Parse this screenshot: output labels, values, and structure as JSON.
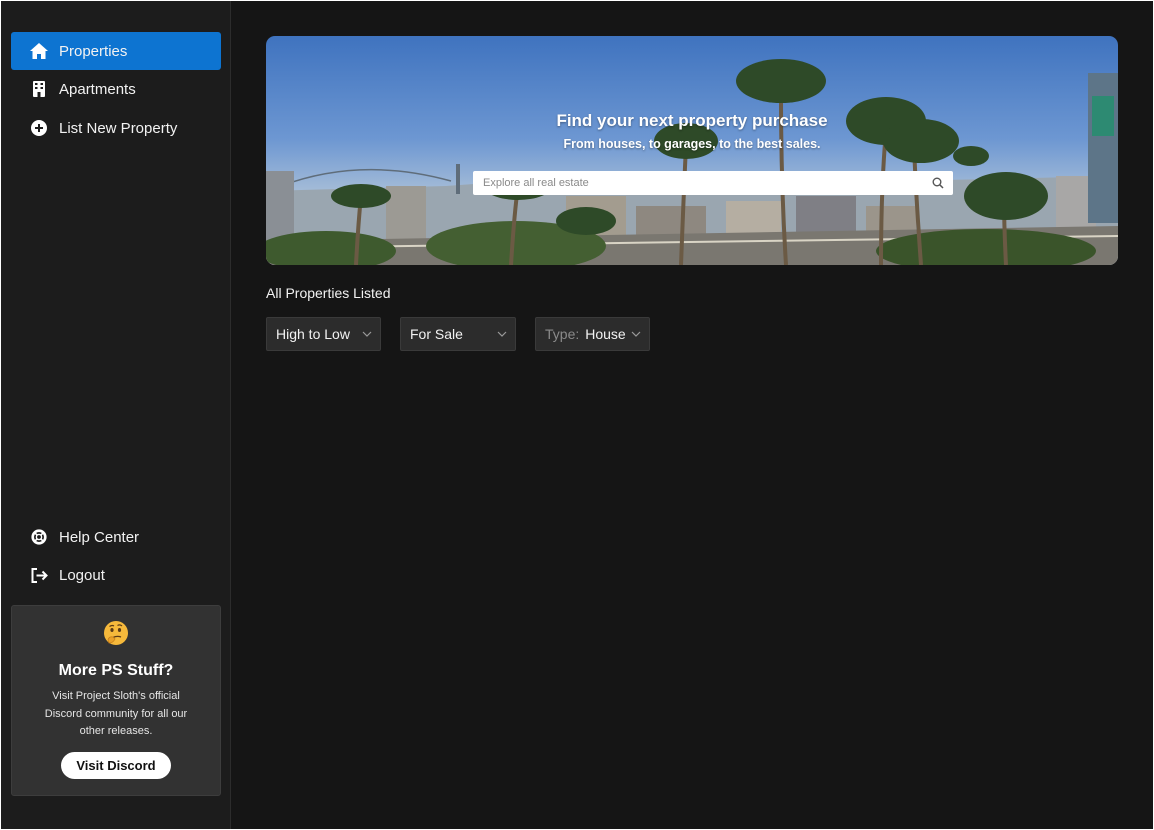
{
  "sidebar": {
    "nav": [
      {
        "label": "Properties",
        "icon": "home-icon",
        "active": true
      },
      {
        "label": "Apartments",
        "icon": "building-icon",
        "active": false
      },
      {
        "label": "List New Property",
        "icon": "plus-circle-icon",
        "active": false
      }
    ],
    "bottom_nav": [
      {
        "label": "Help Center",
        "icon": "lifebuoy-icon"
      },
      {
        "label": "Logout",
        "icon": "logout-icon"
      }
    ],
    "promo": {
      "emoji": "thinking-face-icon",
      "title": "More PS Stuff?",
      "description": "Visit Project Sloth's official Discord community for all our other releases.",
      "button_label": "Visit Discord"
    }
  },
  "hero": {
    "title": "Find your next property purchase",
    "subtitle": "From houses, to garages, to the best sales.",
    "search_placeholder": "Explore all real estate"
  },
  "listing": {
    "section_title": "All Properties Listed",
    "filters": {
      "sort": "High to Low",
      "status": "For Sale",
      "type_prefix": "Type:",
      "type_value": "House"
    }
  },
  "colors": {
    "accent": "#0d74d1",
    "background": "#151515",
    "sidebar": "#1c1c1c",
    "dropdown": "#2c2c2c"
  }
}
